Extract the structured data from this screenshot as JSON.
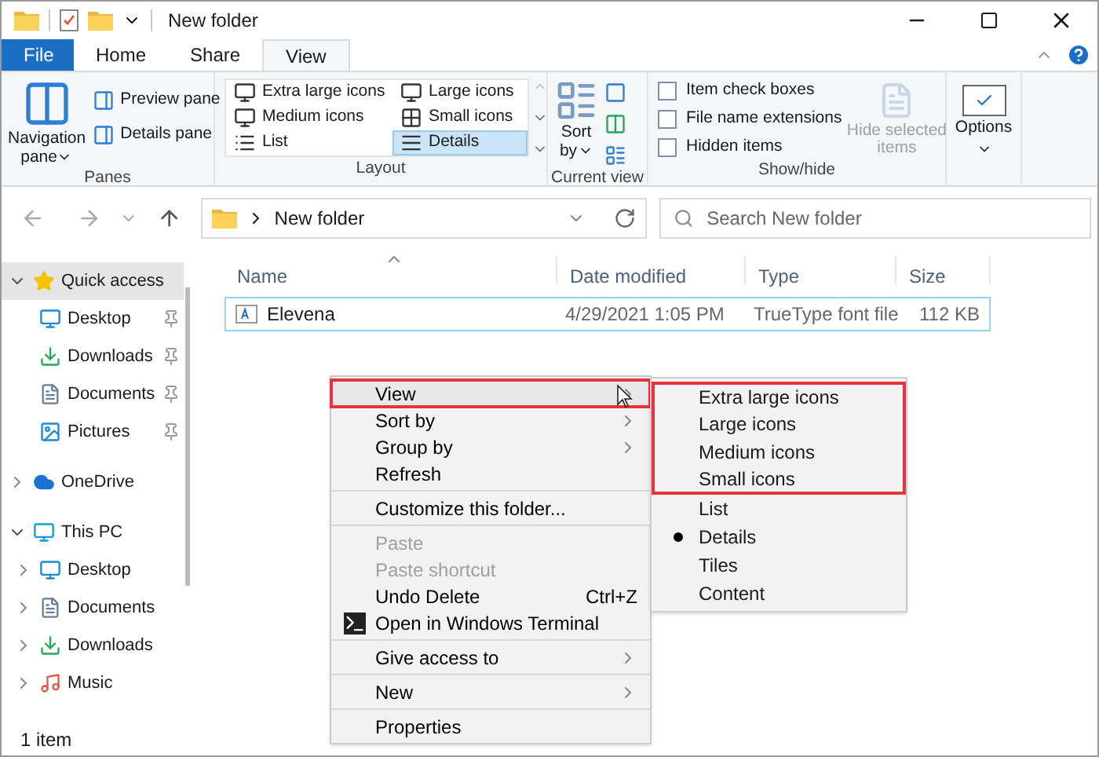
{
  "window": {
    "title": "New folder"
  },
  "tabs": [
    {
      "label": "File",
      "kind": "file",
      "selected": false
    },
    {
      "label": "Home",
      "kind": "tab",
      "selected": false
    },
    {
      "label": "Share",
      "kind": "tab",
      "selected": false
    },
    {
      "label": "View",
      "kind": "tab",
      "selected": true
    }
  ],
  "ribbon": {
    "panes": {
      "label": "Panes",
      "navigation": [
        "Navigation",
        "pane"
      ],
      "buttons": [
        "Preview pane",
        "Details pane"
      ]
    },
    "layout": {
      "label": "Layout",
      "items": [
        {
          "label": "Extra large icons",
          "selected": false
        },
        {
          "label": "Large icons",
          "selected": false
        },
        {
          "label": "Medium icons",
          "selected": false
        },
        {
          "label": "Small icons",
          "selected": false
        },
        {
          "label": "List",
          "selected": false
        },
        {
          "label": "Details",
          "selected": true
        }
      ]
    },
    "current_view": {
      "label": "Current view",
      "sort": [
        "Sort",
        "by"
      ]
    },
    "show_hide": {
      "label": "Show/hide",
      "checkboxes": [
        {
          "label": "Item check boxes",
          "checked": false
        },
        {
          "label": "File name extensions",
          "checked": false
        },
        {
          "label": "Hidden items",
          "checked": false
        }
      ],
      "hide_selected": {
        "lines": [
          "Hide selected",
          "items"
        ],
        "disabled": true
      }
    },
    "options": {
      "label": "Options"
    }
  },
  "address": {
    "path": "New folder",
    "search_placeholder": "Search New folder"
  },
  "nav": [
    {
      "label": "Quick access",
      "kind": "star",
      "expanded": true,
      "selected": true,
      "children": [
        {
          "label": "Desktop",
          "kind": "desktop",
          "pinned": true
        },
        {
          "label": "Downloads",
          "kind": "download",
          "pinned": true
        },
        {
          "label": "Documents",
          "kind": "document",
          "pinned": true
        },
        {
          "label": "Pictures",
          "kind": "pictures",
          "pinned": true
        }
      ]
    },
    {
      "label": "OneDrive",
      "kind": "cloud",
      "expanded": false,
      "selected": false
    },
    {
      "label": "This PC",
      "kind": "pc",
      "expanded": true,
      "selected": false,
      "children": [
        {
          "label": "Desktop",
          "kind": "desktop",
          "expanded": false
        },
        {
          "label": "Documents",
          "kind": "document",
          "expanded": false
        },
        {
          "label": "Downloads",
          "kind": "download",
          "expanded": false
        },
        {
          "label": "Music",
          "kind": "music",
          "expanded": false
        }
      ]
    }
  ],
  "table": {
    "columns": [
      "Name",
      "Date modified",
      "Type",
      "Size"
    ],
    "rows": [
      {
        "selected": true,
        "cells": [
          "Elevena",
          "4/29/2021 1:05 PM",
          "TrueType font file",
          "112 KB"
        ]
      }
    ]
  },
  "status_bar": "1 item",
  "context_menu": {
    "groups": [
      [
        {
          "label": "View",
          "submenu": true,
          "highlighted": true
        },
        {
          "label": "Sort by",
          "submenu": true,
          "highlighted": false
        },
        {
          "label": "Group by",
          "submenu": true,
          "highlighted": false
        },
        {
          "label": "Refresh",
          "highlighted": false
        }
      ],
      [
        {
          "label": "Customize this folder...",
          "highlighted": false
        }
      ],
      [
        {
          "label": "Paste",
          "disabled": true,
          "highlighted": false
        },
        {
          "label": "Paste shortcut",
          "disabled": true,
          "highlighted": false
        },
        {
          "label": "Undo Delete",
          "shortcut": "Ctrl+Z",
          "highlighted": false
        },
        {
          "label": "Open in Windows Terminal",
          "kind": "terminal",
          "highlighted": false
        }
      ],
      [
        {
          "label": "Give access to",
          "submenu": true,
          "highlighted": false
        }
      ],
      [
        {
          "label": "New",
          "submenu": true,
          "highlighted": false
        }
      ],
      [
        {
          "label": "Properties",
          "highlighted": false
        }
      ]
    ]
  },
  "view_submenu": [
    {
      "label": "Extra large icons",
      "highlighted": true,
      "selected": false
    },
    {
      "label": "Large icons",
      "highlighted": true,
      "selected": false
    },
    {
      "label": "Medium icons",
      "highlighted": true,
      "selected": false
    },
    {
      "label": "Small icons",
      "highlighted": true,
      "selected": false
    },
    {
      "label": "List",
      "highlighted": false,
      "selected": false
    },
    {
      "label": "Details",
      "highlighted": false,
      "selected": true
    },
    {
      "label": "Tiles",
      "highlighted": false,
      "selected": false
    },
    {
      "label": "Content",
      "highlighted": false,
      "selected": false
    }
  ]
}
